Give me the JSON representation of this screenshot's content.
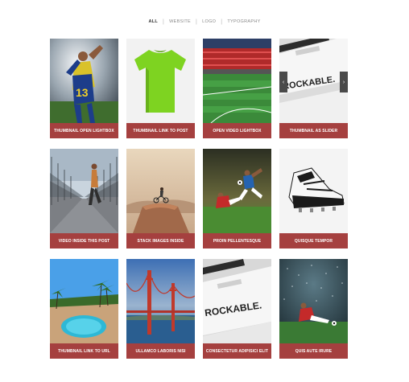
{
  "filters": [
    {
      "label": "All",
      "active": true
    },
    {
      "label": "Website",
      "active": false
    },
    {
      "label": "Logo",
      "active": false
    },
    {
      "label": "Typography",
      "active": false
    }
  ],
  "items": [
    {
      "caption": "Thumbnail Open Lightbox",
      "icon": "soccer-players-celebrating-image"
    },
    {
      "caption": "Thumbnail Link to Post",
      "icon": "green-tshirt-image"
    },
    {
      "caption": "Open Video Lightbox",
      "icon": "stadium-image"
    },
    {
      "caption": "Thumbnail as Slider",
      "icon": "business-card-image"
    },
    {
      "caption": "Video Inside This Post",
      "icon": "runner-bridge-image"
    },
    {
      "caption": "Stack Images Inside",
      "icon": "cyclist-rock-image"
    },
    {
      "caption": "Proin Pellentesque",
      "icon": "soccer-tackle-image"
    },
    {
      "caption": "Quisque Tempor",
      "icon": "soccer-boot-image"
    },
    {
      "caption": "Thumbnail Link to URL",
      "icon": "pool-palms-image"
    },
    {
      "caption": "Ullamco Laboris Nisi",
      "icon": "golden-gate-image"
    },
    {
      "caption": "Consectetur Adipisici Elit",
      "icon": "business-card-image"
    },
    {
      "caption": "Quis Aute Irure",
      "icon": "soccer-slide-image"
    }
  ],
  "slider": {
    "prev_glyph": "‹",
    "next_glyph": "›"
  },
  "card_text": "ROCKABLE.",
  "colors": {
    "caption_bg": "#a5403f",
    "filter_active": "#333333",
    "filter_inactive": "#8a8a8a"
  }
}
